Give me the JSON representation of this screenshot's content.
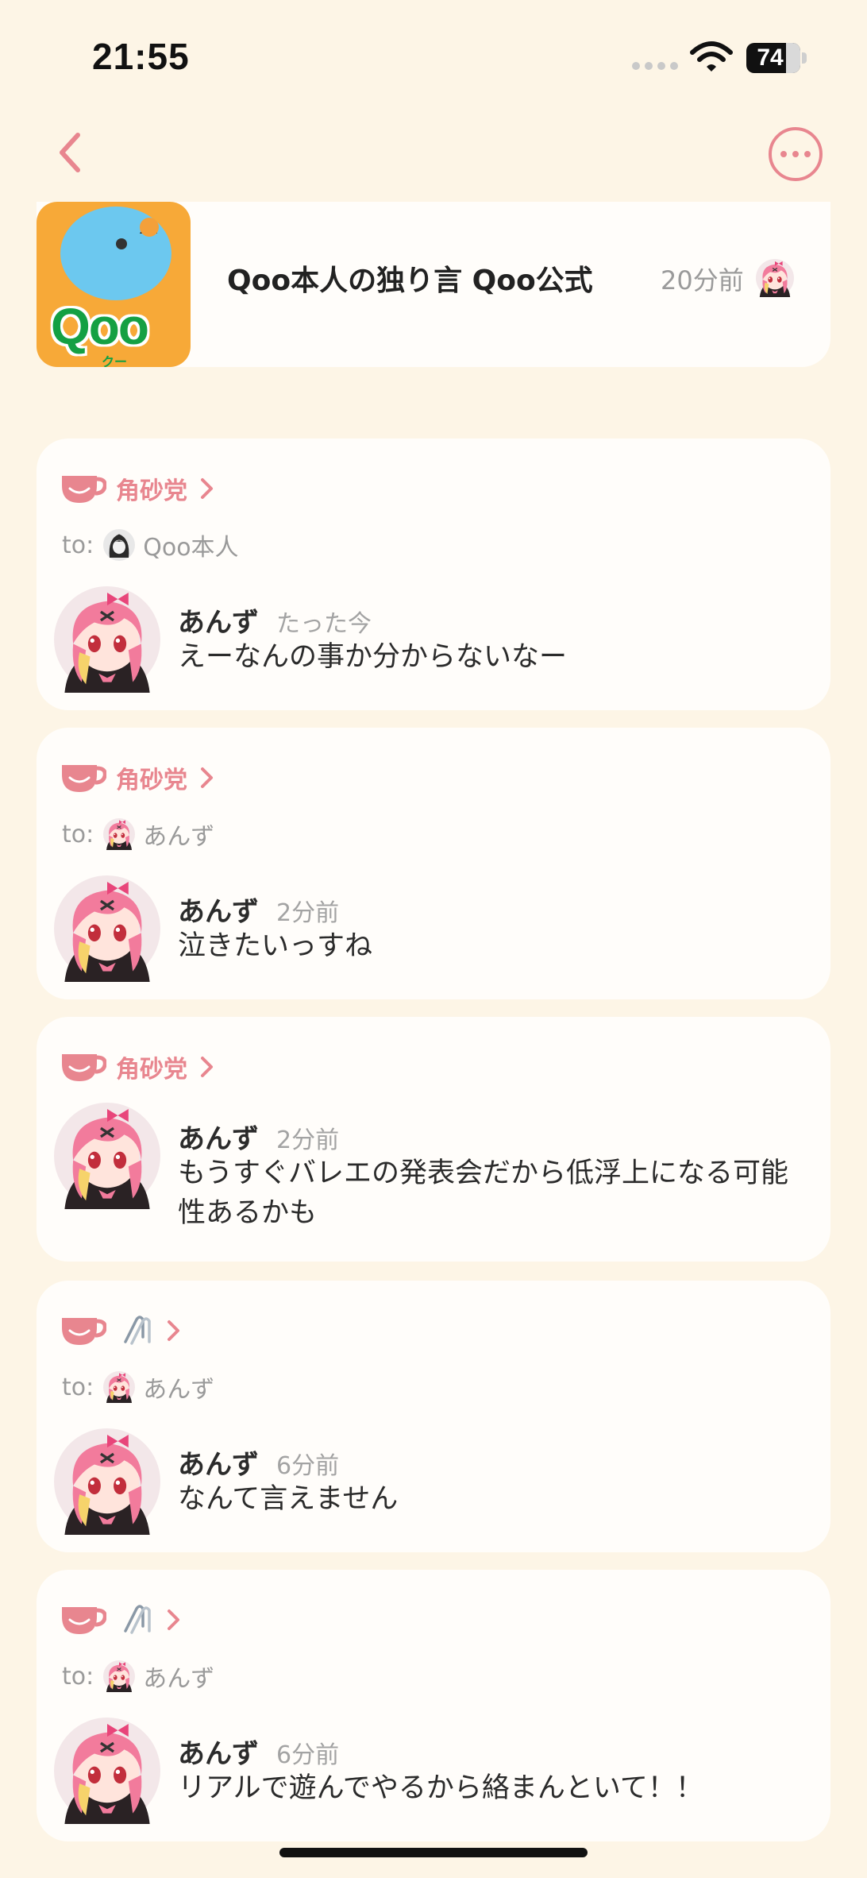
{
  "status_bar": {
    "time": "21:55",
    "battery": "74"
  },
  "nav": {
    "back": "back",
    "more": "more"
  },
  "header": {
    "logo_text": "Qoo",
    "logo_sub": "クー",
    "title": "Qoo本人の独り言  Qoo公式",
    "time": "20分前"
  },
  "posts": [
    {
      "group": "角砂党",
      "show_group": true,
      "to_label": "to:",
      "to_name": "Qoo本人",
      "user": "あんず",
      "time": "たった今",
      "text": "えーなんの事か分からないなー"
    },
    {
      "group": "角砂党",
      "show_group": true,
      "to_label": "to:",
      "to_name": "あんず",
      "user": "あんず",
      "time": "2分前",
      "text": "泣きたいっすね"
    },
    {
      "group": "角砂党",
      "show_group": true,
      "user": "あんず",
      "time": "2分前",
      "text": "もうすぐバレエの発表会だから低浮上になる可能性あるかも"
    },
    {
      "show_group": false,
      "to_label": "to:",
      "to_name": "あんず",
      "user": "あんず",
      "time": "6分前",
      "text": "なんて言えません"
    },
    {
      "show_group": false,
      "to_label": "to:",
      "to_name": "あんず",
      "user": "あんず",
      "time": "6分前",
      "text": "リアルで遊んでやるから絡まんといて！！"
    }
  ],
  "colors": {
    "accent": "#e8868f",
    "background": "#fdf5e6",
    "card": "#fffdfa"
  }
}
